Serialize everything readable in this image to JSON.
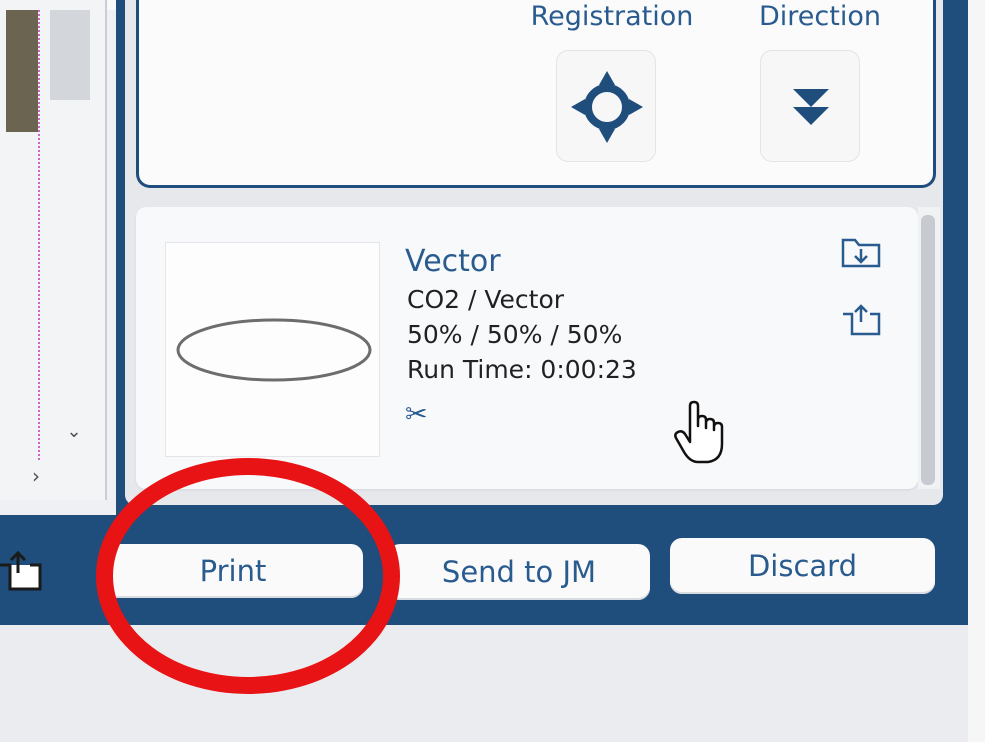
{
  "settings_panel": {
    "registration_label": "Registration",
    "direction_label": "Direction",
    "registration_icon": "crosshair-icon",
    "direction_icon": "double-chevron-down-icon"
  },
  "job": {
    "title": "Vector",
    "laser": "CO2 / Vector",
    "power": "50% / 50% / 50%",
    "runtime": "Run Time: 0:00:23",
    "thumbnail_shape": "ellipse",
    "process_icon": "scissors-icon",
    "import_icon": "folder-download-icon",
    "export_icon": "folder-upload-icon"
  },
  "toolbar": {
    "print_label": "Print",
    "send_label": "Send to JM",
    "discard_label": "Discard",
    "left_icon": "folder-upload-icon"
  },
  "navigation": {
    "scroll_down_icon": "chevron-down-icon",
    "scroll_right_icon": "chevron-right-icon"
  },
  "colors": {
    "frame": "#1f4d7c",
    "accent_text": "#2a5b8f",
    "annotation": "#e81315"
  }
}
